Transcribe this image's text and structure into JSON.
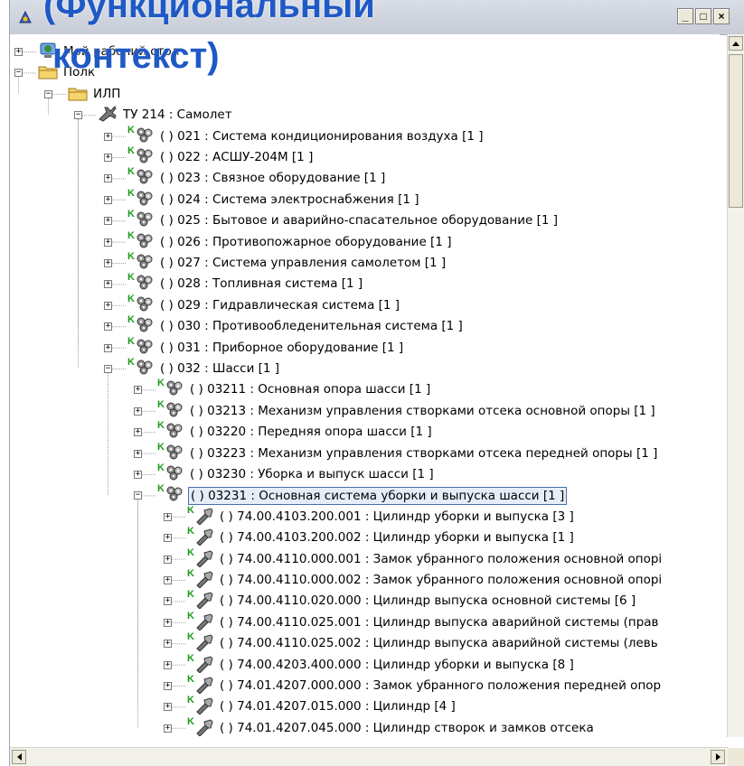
{
  "overlay_title": {
    "line1": "(Функциональный",
    "line2": "контекст)"
  },
  "window": {
    "buttons": [
      "_",
      "□",
      "×"
    ]
  },
  "tree": {
    "nodes": [
      {
        "depth": 0,
        "exp": "+",
        "icon": "desktop",
        "label": "Мой рабочий стол"
      },
      {
        "depth": 0,
        "exp": "−",
        "icon": "folder",
        "label": "Полк"
      },
      {
        "depth": 1,
        "exp": "−",
        "icon": "folder",
        "label": "ИЛП"
      },
      {
        "depth": 2,
        "exp": "−",
        "icon": "airplane",
        "label": "ТУ 214 : Самолет"
      },
      {
        "depth": 3,
        "exp": "+",
        "icon": "system",
        "label": "( ) 021 : Система кондиционирования воздуха [1 ]"
      },
      {
        "depth": 3,
        "exp": "+",
        "icon": "system",
        "label": "( ) 022 : АСШУ-204М [1 ]"
      },
      {
        "depth": 3,
        "exp": "+",
        "icon": "system",
        "label": "( ) 023 : Связное оборудование [1 ]"
      },
      {
        "depth": 3,
        "exp": "+",
        "icon": "system",
        "label": "( ) 024 : Система электроснабжения [1 ]"
      },
      {
        "depth": 3,
        "exp": "+",
        "icon": "system",
        "label": "( ) 025 : Бытовое и аварийно-спасательное оборудование [1 ]"
      },
      {
        "depth": 3,
        "exp": "+",
        "icon": "system",
        "label": "( ) 026 : Противопожарное оборудование [1 ]"
      },
      {
        "depth": 3,
        "exp": "+",
        "icon": "system",
        "label": "( ) 027 : Система управления самолетом [1 ]"
      },
      {
        "depth": 3,
        "exp": "+",
        "icon": "system",
        "label": "( ) 028 : Топливная система [1 ]"
      },
      {
        "depth": 3,
        "exp": "+",
        "icon": "system",
        "label": "( ) 029 : Гидравлическая система [1 ]"
      },
      {
        "depth": 3,
        "exp": "+",
        "icon": "system",
        "label": "( ) 030 : Противообледенительная система [1 ]"
      },
      {
        "depth": 3,
        "exp": "+",
        "icon": "system",
        "label": "( ) 031 : Приборное оборудование [1 ]"
      },
      {
        "depth": 3,
        "exp": "−",
        "icon": "system",
        "label": "( ) 032 : Шасси [1 ]"
      },
      {
        "depth": 4,
        "exp": "+",
        "icon": "system",
        "label": "( ) 03211 : Основная опора шасси [1 ]"
      },
      {
        "depth": 4,
        "exp": "+",
        "icon": "system",
        "label": "( ) 03213 : Механизм управления створками отсека основной опоры [1 ]"
      },
      {
        "depth": 4,
        "exp": "+",
        "icon": "system",
        "label": "( ) 03220 : Передняя опора шасси [1 ]"
      },
      {
        "depth": 4,
        "exp": "+",
        "icon": "system",
        "label": "( ) 03223 : Механизм управления створками отсека передней опоры [1 ]"
      },
      {
        "depth": 4,
        "exp": "+",
        "icon": "system",
        "label": "( ) 03230 : Уборка и выпуск шасси [1 ]"
      },
      {
        "depth": 4,
        "exp": "−",
        "icon": "system",
        "label": "( ) 03231 : Основная система уборки и выпуска шасси [1 ]",
        "selected": true
      },
      {
        "depth": 5,
        "exp": "+",
        "icon": "part",
        "label": "( ) 74.00.4103.200.001 : Цилиндр уборки и выпуска [3 ]"
      },
      {
        "depth": 5,
        "exp": "+",
        "icon": "part",
        "label": "( ) 74.00.4103.200.002 : Цилиндр уборки и выпуска [1 ]"
      },
      {
        "depth": 5,
        "exp": "+",
        "icon": "part",
        "label": "( ) 74.00.4110.000.001 : Замок убранного положения основной опорі"
      },
      {
        "depth": 5,
        "exp": "+",
        "icon": "part",
        "label": "( ) 74.00.4110.000.002 : Замок убранного положения основной опорі"
      },
      {
        "depth": 5,
        "exp": "+",
        "icon": "part",
        "label": "( ) 74.00.4110.020.000 : Цилиндр выпуска основной системы [6 ]"
      },
      {
        "depth": 5,
        "exp": "+",
        "icon": "part",
        "label": "( ) 74.00.4110.025.001 : Цилиндр выпуска аварийной системы (прав"
      },
      {
        "depth": 5,
        "exp": "+",
        "icon": "part",
        "label": "( ) 74.00.4110.025.002 : Цилиндр выпуска аварийной системы (левь"
      },
      {
        "depth": 5,
        "exp": "+",
        "icon": "part",
        "label": "( ) 74.00.4203.400.000 : Цилиндр уборки и выпуска [8 ]"
      },
      {
        "depth": 5,
        "exp": "+",
        "icon": "part",
        "label": "( ) 74.01.4207.000.000 : Замок убранного положения передней опор"
      },
      {
        "depth": 5,
        "exp": "+",
        "icon": "part",
        "label": "( ) 74.01.4207.015.000 : Цилиндр [4 ]"
      },
      {
        "depth": 5,
        "exp": "+",
        "icon": "part",
        "label": "( ) 74.01.4207.045.000 : Цилиндр створок и замков отсека"
      }
    ]
  },
  "colors": {
    "overlay_title": "#1f59c6",
    "k_mark": "#1d9a1d",
    "selection_border": "#4a6ea9"
  }
}
